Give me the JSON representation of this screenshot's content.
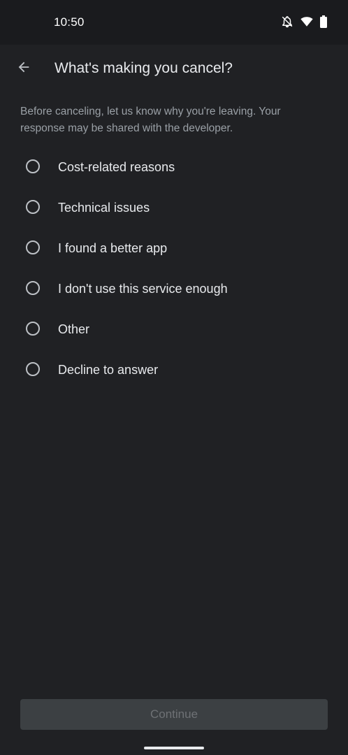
{
  "status_bar": {
    "time": "10:50",
    "icons": [
      "notifications-off-icon",
      "wifi-icon",
      "battery-icon"
    ]
  },
  "app_bar": {
    "back_icon": "arrow-back-icon",
    "title": "What's making you cancel?"
  },
  "description": "Before canceling, let us know why you're leaving. Your response may be shared with the developer.",
  "options": [
    {
      "label": "Cost-related reasons",
      "selected": false
    },
    {
      "label": "Technical issues",
      "selected": false
    },
    {
      "label": "I found a better app",
      "selected": false
    },
    {
      "label": "I don't use this service enough",
      "selected": false
    },
    {
      "label": "Other",
      "selected": false
    },
    {
      "label": "Decline to answer",
      "selected": false
    }
  ],
  "continue_button": {
    "label": "Continue",
    "enabled": false
  },
  "colors": {
    "background": "#202124",
    "status_bar": "#1a1b1e",
    "primary_text": "#e8eaed",
    "secondary_text": "#9aa0a6",
    "disabled_button": "#3c4043"
  }
}
